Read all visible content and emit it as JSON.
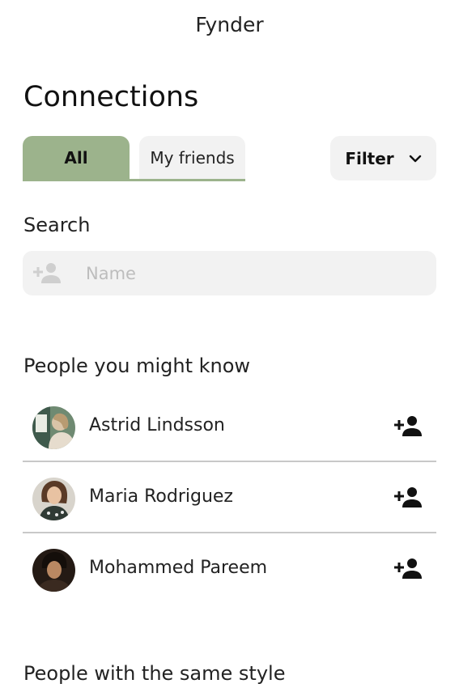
{
  "app": {
    "title": "Fynder"
  },
  "page": {
    "title": "Connections"
  },
  "tabs": [
    {
      "label": "All",
      "active": true
    },
    {
      "label": "My friends",
      "active": false
    }
  ],
  "filter": {
    "label": "Filter",
    "icon": "chevron-down-icon"
  },
  "search": {
    "label": "Search",
    "placeholder": "Name",
    "value": "",
    "icon": "person-add-icon"
  },
  "sections": {
    "suggested": {
      "title": "People you might know"
    },
    "same_style": {
      "title": "People with the same style"
    }
  },
  "people": [
    {
      "name": "Astrid Lindsson",
      "action_icon": "person-add-icon"
    },
    {
      "name": "Maria Rodriguez",
      "action_icon": "person-add-icon"
    },
    {
      "name": "Mohammed Pareem",
      "action_icon": "person-add-icon"
    }
  ],
  "colors": {
    "accent": "#9cb38c",
    "surface": "#f2f2f2",
    "divider": "#c8c8c8"
  }
}
